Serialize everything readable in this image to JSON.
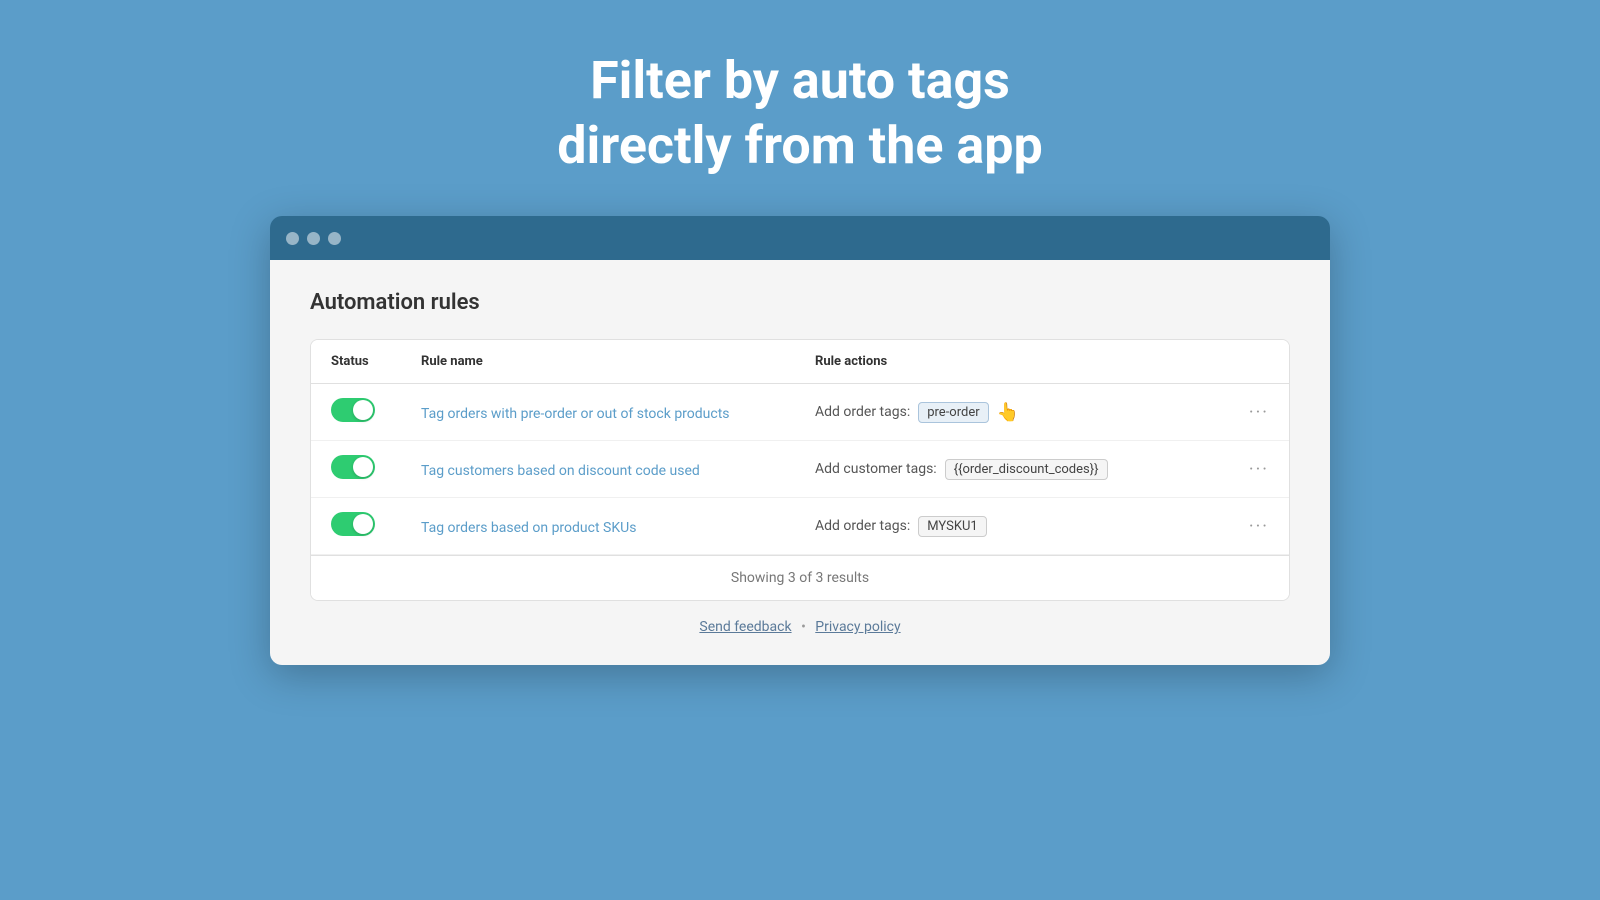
{
  "hero": {
    "line1": "Filter by auto tags",
    "line2": "directly from the app"
  },
  "browser": {
    "page_title": "Automation rules",
    "table": {
      "headers": {
        "status": "Status",
        "rule_name": "Rule name",
        "rule_actions": "Rule actions"
      },
      "rows": [
        {
          "id": "row1",
          "enabled": true,
          "rule_name": "Tag orders with pre-order or out of stock products",
          "action_label": "Add order tags:",
          "tag": "pre-order",
          "tag_type": "highlighted"
        },
        {
          "id": "row2",
          "enabled": true,
          "rule_name": "Tag customers based on discount code used",
          "action_label": "Add customer tags:",
          "tag": "{{order_discount_codes}}",
          "tag_type": "normal"
        },
        {
          "id": "row3",
          "enabled": true,
          "rule_name": "Tag orders based on product SKUs",
          "action_label": "Add order tags:",
          "tag": "MYSKU1",
          "tag_type": "normal"
        }
      ],
      "footer": "Showing 3 of 3 results"
    },
    "footer_links": {
      "send_feedback": "Send feedback",
      "separator": "•",
      "privacy_policy": "Privacy policy"
    }
  }
}
